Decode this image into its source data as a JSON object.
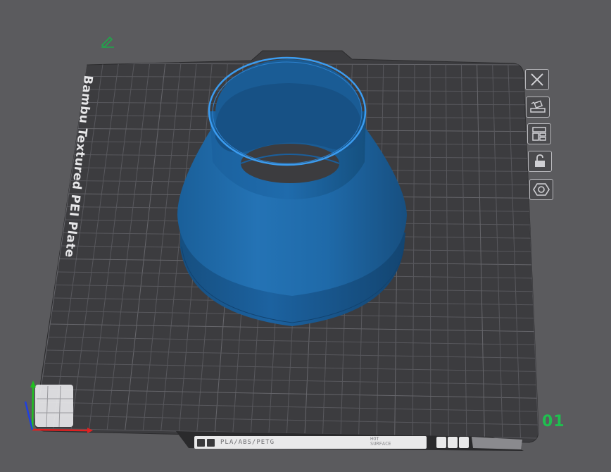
{
  "plate": {
    "name": "Bambu Textured PEI Plate",
    "number": "01",
    "strip_material": "PLA/ABS/PETG",
    "strip_surface_line1": "HOT",
    "strip_surface_line2": "SURFACE"
  },
  "toolbar": {
    "items": [
      {
        "name": "close-plate",
        "icon": "close-icon"
      },
      {
        "name": "auto-orient",
        "icon": "orient-icon"
      },
      {
        "name": "arrange",
        "icon": "arrange-icon"
      },
      {
        "name": "lock-plate",
        "icon": "lock-icon"
      },
      {
        "name": "plate-settings",
        "icon": "hex-settings-icon"
      }
    ]
  },
  "colors": {
    "background": "#5b5b5e",
    "plate": "#3c3c3f",
    "grid": "#55555a",
    "model": "#1e69a8",
    "model_highlight": "#2e8fe0",
    "plate_number": "#1fbf4f",
    "axis_x": "#e02020",
    "axis_y": "#20c020",
    "axis_z": "#2040e0"
  }
}
